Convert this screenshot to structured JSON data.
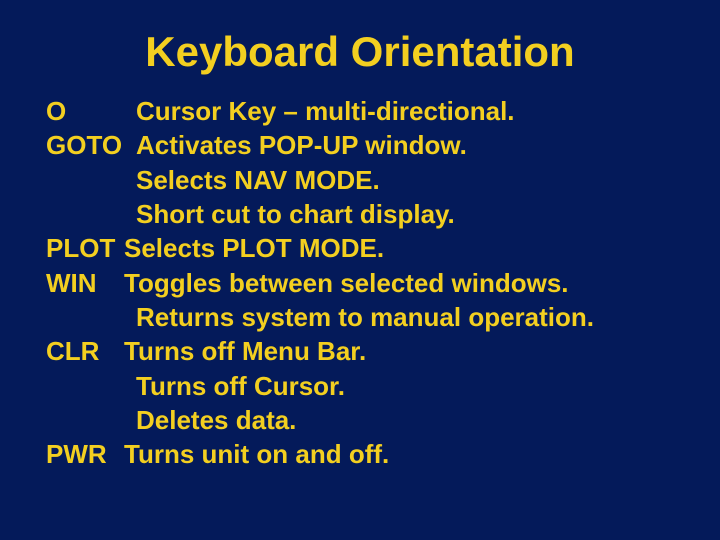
{
  "title": "Keyboard Orientation",
  "lines": {
    "o_key": "O",
    "o_desc": "Cursor Key – multi-directional.",
    "goto_key": "GOTO",
    "goto_desc": "Activates POP-UP window.",
    "goto_desc2": "Selects NAV MODE.",
    "goto_desc3": "Short cut to chart display.",
    "plot_key": "PLOT",
    "plot_desc": "Selects PLOT MODE.",
    "win_key": "WIN",
    "win_desc": "Toggles between selected windows.",
    "win_desc2": "Returns system to manual operation.",
    "clr_key": "CLR",
    "clr_desc": "Turns off Menu Bar.",
    "clr_desc2": "Turns off Cursor.",
    "clr_desc3": "Deletes data.",
    "pwr_key": "PWR",
    "pwr_desc": "Turns unit on and off."
  }
}
